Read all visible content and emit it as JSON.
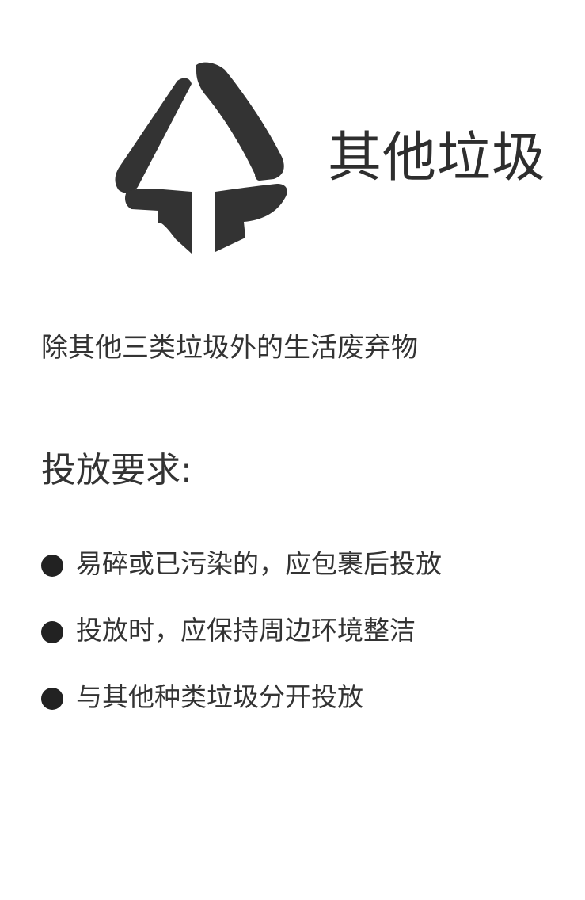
{
  "header": {
    "title": "其他垃圾",
    "logo_icon": "other-waste-icon",
    "logo_color": "#333333"
  },
  "description": "除其他三类垃圾外的生活废弃物",
  "requirements": {
    "heading": "投放要求:",
    "items": [
      "易碎或已污染的，应包裹后投放",
      "投放时，应保持周边环境整洁",
      "与其他种类垃圾分开投放"
    ]
  }
}
